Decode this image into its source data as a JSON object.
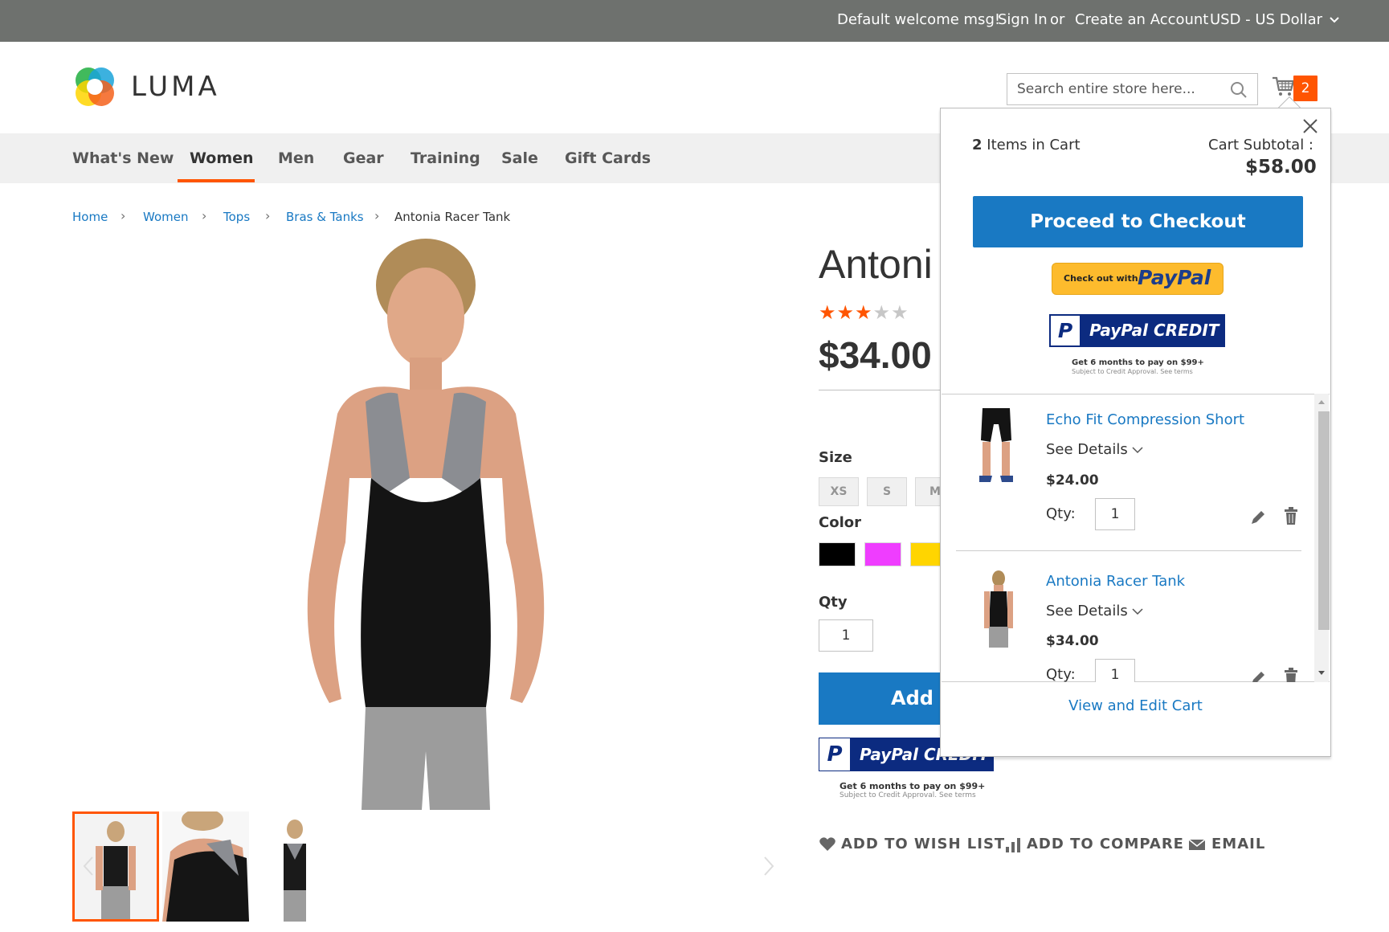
{
  "topbar": {
    "welcome": "Default welcome msg!",
    "sign_in": "Sign In",
    "or": "or",
    "create_account": "Create an Account",
    "currency": "USD - US Dollar"
  },
  "header": {
    "logo_text": "LUMA",
    "search_placeholder": "Search entire store here...",
    "cart_count": "2"
  },
  "nav": {
    "items": [
      "What's New",
      "Women",
      "Men",
      "Gear",
      "Training",
      "Sale",
      "Gift Cards"
    ],
    "active": "Women"
  },
  "breadcrumb": {
    "items": [
      "Home",
      "Women",
      "Tops",
      "Bras & Tanks",
      "Antonia Racer Tank"
    ]
  },
  "product": {
    "title": "Antonia Racer Tank",
    "title_visible": "Antoni",
    "rating": 3,
    "rating_max": 5,
    "price": "$34.00",
    "size_label": "Size",
    "sizes": [
      "XS",
      "S",
      "M"
    ],
    "color_label": "Color",
    "colors": [
      "#000000",
      "#ef3dff",
      "#ffd500"
    ],
    "qty_label": "Qty",
    "qty": "1",
    "add_to_cart": "Add to Cart",
    "paypal_credit": "PayPal CREDIT",
    "paypal_note1": "Get 6 months to pay on $99+",
    "paypal_note2": "Subject to Credit Approval. See terms",
    "actions": {
      "wishlist": "ADD TO WISH LIST",
      "compare": "ADD TO COMPARE",
      "email": "EMAIL"
    }
  },
  "minicart": {
    "count": "2",
    "items_label": "Items in Cart",
    "subtotal_label": "Cart Subtotal :",
    "subtotal": "$58.00",
    "checkout": "Proceed to Checkout",
    "paypal_checkout_prefix": "Check out with",
    "paypal_checkout_brand": "PayPal",
    "paypal_credit": "PayPal CREDIT",
    "paypal_note1": "Get 6 months to pay on $99+",
    "paypal_note2": "Subject to Credit Approval. See terms",
    "items": [
      {
        "name": "Echo Fit Compression Short",
        "details": "See Details",
        "price": "$24.00",
        "qty_label": "Qty:",
        "qty": "1"
      },
      {
        "name": "Antonia Racer Tank",
        "details": "See Details",
        "price": "$34.00",
        "qty_label": "Qty:",
        "qty": "1"
      }
    ],
    "view_edit": "View and Edit Cart"
  },
  "colors": {
    "accent": "#ff5501",
    "primary": "#1979c3",
    "topbar": "#6e716e",
    "nav_bg": "#f0f0f0",
    "paypal_gold": "#fdbb2d",
    "paypal_navy": "#0c2b80"
  }
}
